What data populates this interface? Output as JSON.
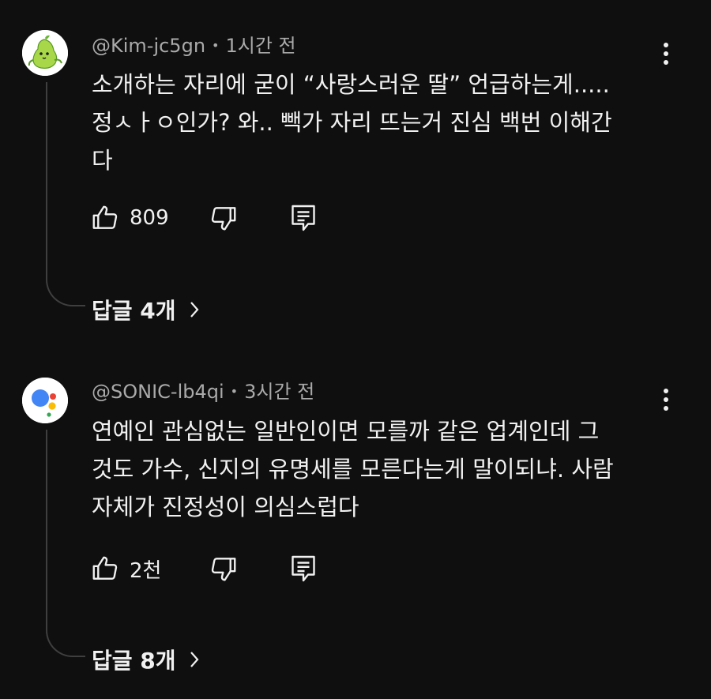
{
  "comments": [
    {
      "author": "@Kim-jc5gn",
      "time": "1시간 전",
      "lines": [
        "소개하는 자리에 굳이 “사랑스러운 딸” 언급하는게.....",
        "정ㅅㅏㅇ인가? 와.. 빽가 자리 뜨는거 진심 백번 이해간",
        "다"
      ],
      "likes": "809",
      "replies_label": "답글 4개",
      "avatar_icon": "green-pear-character-avatar",
      "avatar_bg": "#ffffff"
    },
    {
      "author": "@SONIC-lb4qi",
      "time": "3시간 전",
      "lines": [
        "연예인 관심없는 일반인이면 모를까 같은 업계인데 그",
        "것도 가수, 신지의 유명세를 모른다는게 말이되냐. 사람",
        "자체가 진정성이 의심스럽다"
      ],
      "likes": "2천",
      "replies_label": "답글 8개",
      "avatar_icon": "google-assistant-dots-avatar",
      "avatar_bg": "#ffffff"
    }
  ],
  "meta_separator": "•",
  "icons": {
    "like": "thumbs-up-icon",
    "dislike": "thumbs-down-icon",
    "reply": "comment-icon",
    "more": "more-vert-icon",
    "chevron": "chevron-right-icon"
  },
  "colors": {
    "background": "#0f0f0f",
    "primary_text": "#f1f1f1",
    "secondary_text": "#aaaaaa",
    "thread_line": "#3f3f3f",
    "assistant_blue": "#4285f4",
    "assistant_red": "#ea4335",
    "assistant_yellow": "#fbbc05",
    "assistant_green": "#34a853",
    "pear_green": "#a8d84a"
  }
}
